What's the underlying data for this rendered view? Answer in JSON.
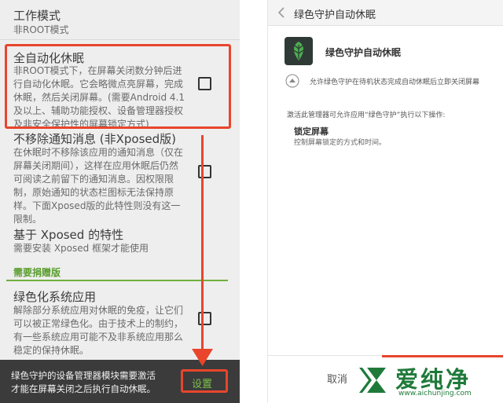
{
  "left": {
    "work_mode_title": "工作模式",
    "work_mode_value": "非ROOT模式",
    "auto_hibernate": {
      "title": "全自动化休眠",
      "desc_lines": [
        "非ROOT模式下，在屏幕关闭数分钟后进",
        "行自动化休眠。它会略微点亮屏幕，完成",
        "休眠，然后关闭屏幕。(需要Android 4.1",
        "及以上、辅助功能授权、设备管理器授权",
        "及非安全保护性的屏幕锁定方式)"
      ]
    },
    "keep_notifications": {
      "title": "不移除通知消息 (非Xposed版)",
      "desc_lines": [
        "在休眠时不移除该应用的通知消息（仅在",
        "屏幕关闭期间），这样在应用休眠后仍然",
        "可阅读之前留下的通知消息。因权限限",
        "制，原始通知的状态栏图标无法保持原",
        "样。下面Xposed版的此特性则没有这一",
        "限制。"
      ]
    },
    "xposed_features": {
      "title": "基于 Xposed 的特性",
      "desc": "需要安装 Xposed 框架才能使用"
    },
    "donate_section": "需要捐赠版",
    "greenify_system": {
      "title": "绿色化系统应用",
      "desc_lines": [
        "解除部分系统应用对休眠的免疫，让它们",
        "可以被正常绿色化。由于技术上的制约，",
        "有一些系统应用可能不及非系统应用那么",
        "稳定的保持休眠。"
      ]
    },
    "bottom_message_lines": [
      "绿色守护的设备管理器模块需要激活",
      "才能在屏幕关闭之后执行自动休眠。"
    ],
    "settings_button": "设置"
  },
  "right": {
    "header_title": "绿色守护自动休眠",
    "back_icon": "chevron-left-icon",
    "app_name": "绿色守护自动休眠",
    "app_icon": "greenify-leaf-icon",
    "allow_text": "允许绿色守护在待机状态完成自动休眠后立即关闭屏幕",
    "activation_text": "激活此管理器可允许应用“绿色守护”执行以下操作:",
    "lock_screen_title": "锁定屏幕",
    "lock_screen_desc": "控制屏幕锁定的方式和时间。",
    "cancel_button": "取消"
  },
  "watermark": {
    "brand": "爱纯净",
    "url": "www.aichunjing.com"
  },
  "colors": {
    "highlight_red": "#e8452c",
    "donate_green": "#5b9e2f",
    "dark_bar": "#3b3b3b",
    "leaf_green": "#4caf50",
    "app_icon_bg": "#2f3a36",
    "watermark_green": "#1f7a3a"
  }
}
